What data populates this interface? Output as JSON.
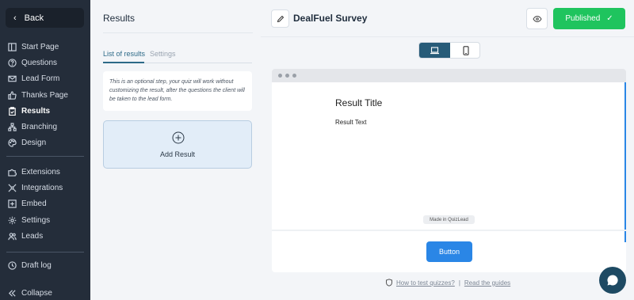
{
  "sidebar": {
    "back_label": "Back",
    "items": [
      {
        "label": "Start Page",
        "icon": "layout-icon"
      },
      {
        "label": "Questions",
        "icon": "question-icon"
      },
      {
        "label": "Lead Form",
        "icon": "mail-icon"
      },
      {
        "label": "Thanks Page",
        "icon": "thumbs-up-icon"
      },
      {
        "label": "Results",
        "icon": "clipboard-icon",
        "active": true
      },
      {
        "label": "Branching",
        "icon": "branching-icon"
      },
      {
        "label": "Design",
        "icon": "palette-icon"
      },
      {
        "label": "Extensions",
        "icon": "puzzle-icon"
      },
      {
        "label": "Integrations",
        "icon": "integrations-icon"
      },
      {
        "label": "Embed",
        "icon": "embed-icon"
      },
      {
        "label": "Settings",
        "icon": "gear-icon"
      },
      {
        "label": "Leads",
        "icon": "users-icon"
      },
      {
        "label": "Draft log",
        "icon": "clock-icon"
      },
      {
        "label": "Collapse",
        "icon": "collapse-icon"
      }
    ]
  },
  "panel": {
    "title": "Results",
    "tabs": [
      "List of results",
      "Settings"
    ],
    "note": "This is an optional step, your quiz will work without customizing the result, after the questions the client will be taken to the lead form.",
    "add_result_label": "Add Result"
  },
  "header": {
    "survey_title": "DealFuel Survey",
    "publish_label": "Published"
  },
  "preview": {
    "result_title": "Result Title",
    "result_text": "Result Text",
    "made_in": "Made in QuizLead",
    "button_label": "Button"
  },
  "help": {
    "test_link": "How to test quizzes?",
    "guides_link": "Read the guides"
  },
  "colors": {
    "sidebar_bg": "#242d3a",
    "accent": "#2a86e6",
    "publish_green": "#1fc45e",
    "chat_bg": "#1e4a63"
  }
}
